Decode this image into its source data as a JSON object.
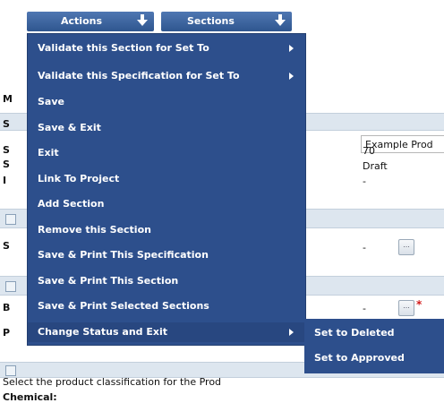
{
  "toolbar": {
    "actions_label": "Actions",
    "sections_label": "Sections"
  },
  "actions_menu": {
    "items": [
      {
        "label": "Validate this Section for Set To",
        "has_submenu": true
      },
      {
        "label": "Validate this Specification for Set To",
        "has_submenu": true
      },
      {
        "label": "Save",
        "has_submenu": false
      },
      {
        "label": "Save & Exit",
        "has_submenu": false
      },
      {
        "label": "Exit",
        "has_submenu": false
      },
      {
        "label": "Link To Project",
        "has_submenu": false
      },
      {
        "label": "Add Section",
        "has_submenu": false
      },
      {
        "label": "Remove this Section",
        "has_submenu": false
      },
      {
        "label": "Save & Print This Specification",
        "has_submenu": false
      },
      {
        "label": "Save & Print This Section",
        "has_submenu": false
      },
      {
        "label": "Save & Print Selected Sections",
        "has_submenu": false
      },
      {
        "label": "Change Status and Exit",
        "has_submenu": true,
        "highlighted": true
      }
    ]
  },
  "status_submenu": {
    "items": [
      "Set to Deleted",
      "Set to Approved"
    ]
  },
  "form": {
    "side_labels": [
      "M",
      "S",
      "S",
      "S",
      "I",
      "S",
      "B",
      "P"
    ],
    "spec_name_value": "Example Prod",
    "version_value": "70",
    "status_value": "Draft",
    "issue_value": "-",
    "dash_1": "-",
    "dash_2": "-",
    "ellipsis": "...",
    "required_mark": "*"
  },
  "footer": {
    "instruction_text": "Select the product classification for the Prod",
    "chemical_label": "Chemical:"
  },
  "colors": {
    "menu_bg": "#2d4f8c",
    "tab_bg": "#3a62a0",
    "section_bar": "#dde6ef",
    "required": "#d21a1a"
  }
}
